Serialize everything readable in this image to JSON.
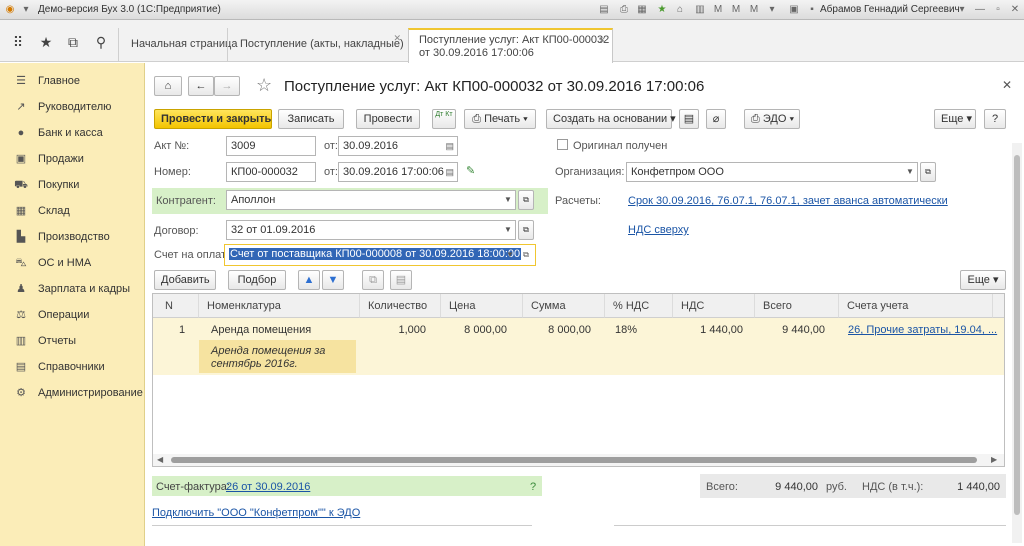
{
  "window": {
    "title": "Демо-версия Бух 3.0  (1С:Предприятие)",
    "user": "Абрамов Геннадий Сергеевич"
  },
  "tabs": [
    {
      "label": "Начальная страница"
    },
    {
      "label": "Поступление (акты, накладные)"
    },
    {
      "label_line1": "Поступление услуг: Акт КП00-000032",
      "label_line2": "от 30.09.2016 17:00:06"
    }
  ],
  "sidebar": {
    "items": [
      {
        "label": "Главное",
        "icon": "menu-icon"
      },
      {
        "label": "Руководителю",
        "icon": "chart-icon"
      },
      {
        "label": "Банк и касса",
        "icon": "coin-icon"
      },
      {
        "label": "Продажи",
        "icon": "cart-icon"
      },
      {
        "label": "Покупки",
        "icon": "shopping-cart-icon"
      },
      {
        "label": "Склад",
        "icon": "warehouse-icon"
      },
      {
        "label": "Производство",
        "icon": "factory-icon"
      },
      {
        "label": "ОС и НМА",
        "icon": "truck-icon"
      },
      {
        "label": "Зарплата и кадры",
        "icon": "person-icon"
      },
      {
        "label": "Операции",
        "icon": "operations-icon"
      },
      {
        "label": "Отчеты",
        "icon": "report-icon"
      },
      {
        "label": "Справочники",
        "icon": "book-icon"
      },
      {
        "label": "Администрирование",
        "icon": "gear-icon"
      }
    ]
  },
  "form": {
    "title": "Поступление услуг: Акт КП00-000032 от 30.09.2016 17:00:06",
    "toolbar": {
      "post_close": "Провести и закрыть",
      "save": "Записать",
      "post": "Провести",
      "print": "Печать",
      "create_based": "Создать на основании",
      "edo": "ЭДО",
      "more": "Еще",
      "help": "?",
      "dtkt": "Дт Кт"
    },
    "fields": {
      "act_no_label": "Акт №:",
      "act_no": "3009",
      "from_label": "от:",
      "act_date": "30.09.2016",
      "number_label": "Номер:",
      "number": "КП00-000032",
      "from2_label": "от:",
      "number_date": "30.09.2016 17:00:06",
      "original_label": "Оригинал получен",
      "org_label": "Организация:",
      "org": "Конфетпром ООО",
      "contractor_label": "Контрагент:",
      "contractor": "Аполлон",
      "settlements_label": "Расчеты:",
      "settlements_link": "Срок 30.09.2016, 76.07.1, 76.07.1, зачет аванса автоматически",
      "contract_label": "Договор:",
      "contract": "32 от 01.09.2016",
      "vat_link": "НДС сверху",
      "invoice_label": "Счет на оплату:",
      "invoice": "Счет от поставщика КП00-000008 от 30.09.2016 18:00:00"
    },
    "table_toolbar": {
      "add": "Добавить",
      "select": "Подбор",
      "more": "Еще"
    },
    "table": {
      "columns": [
        "N",
        "Номенклатура",
        "Количество",
        "Цена",
        "Сумма",
        "% НДС",
        "НДС",
        "Всего",
        "Счета учета"
      ],
      "rows": [
        {
          "n": "1",
          "item": "Аренда помещения",
          "content_line1": "Аренда помещения за",
          "content_line2": "сентябрь 2016г.",
          "qty": "1,000",
          "price": "8 000,00",
          "sum": "8 000,00",
          "vat_rate": "18%",
          "vat": "1 440,00",
          "total": "9 440,00",
          "accounts": "26, Прочие затраты, 19.04, ..."
        }
      ]
    },
    "footer": {
      "invoice_label": "Счет-фактура:",
      "invoice_link": "26 от 30.09.2016",
      "help": "?",
      "total_label": "Всего:",
      "total": "9 440,00",
      "currency": "руб.",
      "vat_label": "НДС (в т.ч.):",
      "vat": "1 440,00",
      "edo_link": "Подключить \"ООО \"Конфетпром\"\" к ЭДО"
    }
  }
}
